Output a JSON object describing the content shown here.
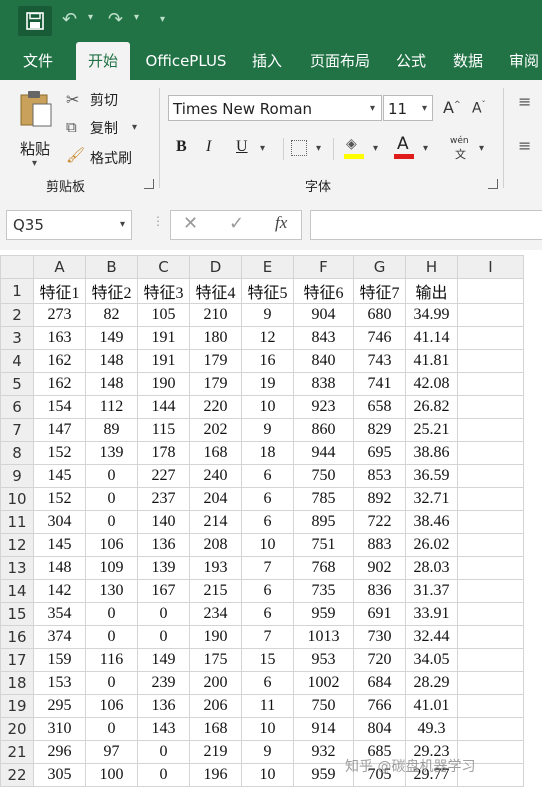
{
  "tabs": [
    "文件",
    "开始",
    "OfficePLUS",
    "插入",
    "页面布局",
    "公式",
    "数据",
    "审阅"
  ],
  "clipboard": {
    "paste": "粘贴",
    "cut": "剪切",
    "copy": "复制",
    "format_painter": "格式刷",
    "group": "剪贴板"
  },
  "font": {
    "name": "Times New Roman",
    "size": "11",
    "group": "字体",
    "bold": "B",
    "italic": "I",
    "underline": "U",
    "font_color": "A",
    "phonetic": "wén"
  },
  "formula_bar": {
    "cell_ref": "Q35",
    "fx": "fx"
  },
  "columns": [
    "A",
    "B",
    "C",
    "D",
    "E",
    "F",
    "G",
    "H",
    "I"
  ],
  "rows": [
    [
      "1",
      "特征1",
      "特征2",
      "特征3",
      "特征4",
      "特征5",
      "特征6",
      "特征7",
      "输出",
      ""
    ],
    [
      "2",
      "273",
      "82",
      "105",
      "210",
      "9",
      "904",
      "680",
      "34.99",
      ""
    ],
    [
      "3",
      "163",
      "149",
      "191",
      "180",
      "12",
      "843",
      "746",
      "41.14",
      ""
    ],
    [
      "4",
      "162",
      "148",
      "191",
      "179",
      "16",
      "840",
      "743",
      "41.81",
      ""
    ],
    [
      "5",
      "162",
      "148",
      "190",
      "179",
      "19",
      "838",
      "741",
      "42.08",
      ""
    ],
    [
      "6",
      "154",
      "112",
      "144",
      "220",
      "10",
      "923",
      "658",
      "26.82",
      ""
    ],
    [
      "7",
      "147",
      "89",
      "115",
      "202",
      "9",
      "860",
      "829",
      "25.21",
      ""
    ],
    [
      "8",
      "152",
      "139",
      "178",
      "168",
      "18",
      "944",
      "695",
      "38.86",
      ""
    ],
    [
      "9",
      "145",
      "0",
      "227",
      "240",
      "6",
      "750",
      "853",
      "36.59",
      ""
    ],
    [
      "10",
      "152",
      "0",
      "237",
      "204",
      "6",
      "785",
      "892",
      "32.71",
      ""
    ],
    [
      "11",
      "304",
      "0",
      "140",
      "214",
      "6",
      "895",
      "722",
      "38.46",
      ""
    ],
    [
      "12",
      "145",
      "106",
      "136",
      "208",
      "10",
      "751",
      "883",
      "26.02",
      ""
    ],
    [
      "13",
      "148",
      "109",
      "139",
      "193",
      "7",
      "768",
      "902",
      "28.03",
      ""
    ],
    [
      "14",
      "142",
      "130",
      "167",
      "215",
      "6",
      "735",
      "836",
      "31.37",
      ""
    ],
    [
      "15",
      "354",
      "0",
      "0",
      "234",
      "6",
      "959",
      "691",
      "33.91",
      ""
    ],
    [
      "16",
      "374",
      "0",
      "0",
      "190",
      "7",
      "1013",
      "730",
      "32.44",
      ""
    ],
    [
      "17",
      "159",
      "116",
      "149",
      "175",
      "15",
      "953",
      "720",
      "34.05",
      ""
    ],
    [
      "18",
      "153",
      "0",
      "239",
      "200",
      "6",
      "1002",
      "684",
      "28.29",
      ""
    ],
    [
      "19",
      "295",
      "106",
      "136",
      "206",
      "11",
      "750",
      "766",
      "41.01",
      ""
    ],
    [
      "20",
      "310",
      "0",
      "143",
      "168",
      "10",
      "914",
      "804",
      "49.3",
      ""
    ],
    [
      "21",
      "296",
      "97",
      "0",
      "219",
      "9",
      "932",
      "685",
      "29.23",
      ""
    ],
    [
      "22",
      "305",
      "100",
      "0",
      "196",
      "10",
      "959",
      "705",
      "29.77",
      ""
    ]
  ],
  "watermark": "知乎 @碳盘机器学习",
  "colors": {
    "excel_green": "#217346"
  }
}
